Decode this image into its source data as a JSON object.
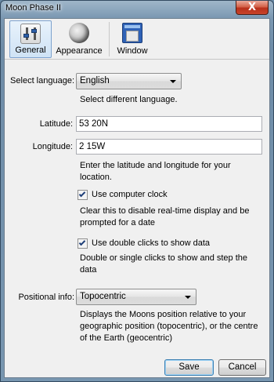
{
  "window": {
    "title": "Moon Phase II",
    "close_label": "X"
  },
  "toolbar": {
    "buttons": [
      {
        "label": "General",
        "icon": "settings-sliders-icon",
        "active": true
      },
      {
        "label": "Appearance",
        "icon": "moon-icon",
        "active": false
      },
      {
        "label": "Window",
        "icon": "window-icon",
        "active": false
      }
    ]
  },
  "language": {
    "label": "Select language:",
    "selected": "English",
    "help": "Select different language."
  },
  "latitude": {
    "label": "Latitude:",
    "value": "53 20N"
  },
  "longitude": {
    "label": "Longitude:",
    "value": "2 15W"
  },
  "coords_help": "Enter the latitude and longitude for your location.",
  "computer_clock": {
    "label": "Use computer clock",
    "checked": true,
    "help": "Clear this to disable real-time display and be prompted for a date"
  },
  "double_clicks": {
    "label": "Use double clicks to show data",
    "checked": true,
    "help": "Double or single clicks to show and step the data"
  },
  "positional": {
    "label": "Positional info:",
    "selected": "Topocentric",
    "help": "Displays the Moons position relative to your geographic position (topocentric), or the centre of the Earth (geocentric)"
  },
  "actions": {
    "save": "Save",
    "cancel": "Cancel"
  }
}
